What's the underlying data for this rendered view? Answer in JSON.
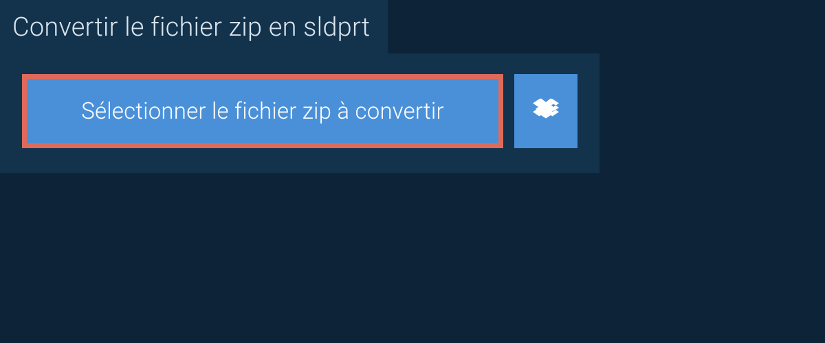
{
  "header": {
    "title": "Convertir le fichier zip en sldprt"
  },
  "actions": {
    "select_file_label": "Sélectionner le fichier zip à convertir",
    "dropbox_icon": "dropbox-icon"
  },
  "colors": {
    "background": "#0d2438",
    "panel": "#13324c",
    "button_primary": "#4a90d9",
    "highlight_border": "#e06a5a",
    "text_light": "#d9e4ed"
  }
}
